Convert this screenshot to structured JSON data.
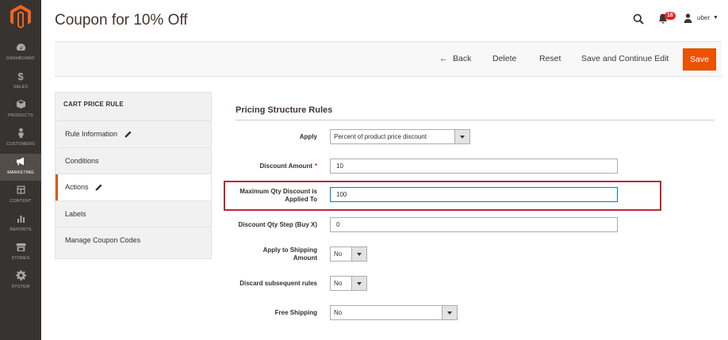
{
  "app": {
    "title": "Coupon for 10% Off"
  },
  "sidebar": {
    "items": [
      {
        "label": "Dashboard",
        "icon": "speedometer-icon"
      },
      {
        "label": "Sales",
        "icon": "dollar-icon"
      },
      {
        "label": "Products",
        "icon": "cube-icon"
      },
      {
        "label": "Customers",
        "icon": "person-icon"
      },
      {
        "label": "Marketing",
        "icon": "megaphone-icon"
      },
      {
        "label": "Content",
        "icon": "layout-icon"
      },
      {
        "label": "Reports",
        "icon": "bar-chart-icon"
      },
      {
        "label": "Stores",
        "icon": "store-icon"
      },
      {
        "label": "System",
        "icon": "gear-icon"
      }
    ],
    "active_index": 4
  },
  "header": {
    "notifications_count": "16",
    "user_name": "uber"
  },
  "toolbar": {
    "back_label": "Back",
    "delete_label": "Delete",
    "reset_label": "Reset",
    "save_continue_label": "Save and Continue Edit",
    "save_label": "Save"
  },
  "tabs": {
    "title": "CART PRICE RULE",
    "items": [
      {
        "label": "Rule Information",
        "has_edit": true
      },
      {
        "label": "Conditions",
        "has_edit": false
      },
      {
        "label": "Actions",
        "has_edit": true
      },
      {
        "label": "Labels",
        "has_edit": false
      },
      {
        "label": "Manage Coupon Codes",
        "has_edit": false
      }
    ],
    "active_index": 2
  },
  "form": {
    "section_title": "Pricing Structure Rules",
    "apply": {
      "label": "Apply",
      "value": "Percent of product price discount"
    },
    "discount_amount": {
      "label": "Discount Amount",
      "value": "10",
      "required": "*"
    },
    "max_qty": {
      "label_line1": "Maximum Qty Discount is",
      "label_line2": "Applied To",
      "value": "100"
    },
    "discount_step": {
      "label": "Discount Qty Step (Buy X)",
      "value": "0"
    },
    "apply_shipping": {
      "label_line1": "Apply to Shipping",
      "label_line2": "Amount",
      "value": "No"
    },
    "discard_rules": {
      "label": "Discard subsequent rules",
      "value": "No"
    },
    "free_shipping": {
      "label": "Free Shipping",
      "value": "No"
    }
  },
  "colors": {
    "sidebar_bg": "#373330",
    "accent": "#eb5202",
    "highlight": "#c0272d",
    "focus_border": "#007bdb"
  }
}
